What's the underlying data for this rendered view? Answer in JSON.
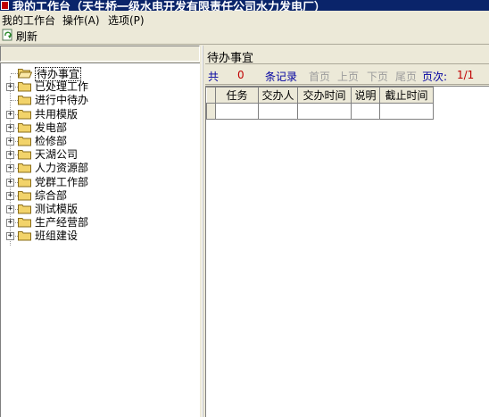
{
  "window": {
    "title": "我的工作台（天生桥一级水电开发有限责任公司水力发电厂）"
  },
  "menu": {
    "items": [
      {
        "label": "我的工作台"
      },
      {
        "label": "操作(A)"
      },
      {
        "label": "选项(P)"
      }
    ]
  },
  "toolbar": {
    "refresh_label": "刷新",
    "refresh_icon": "refresh-icon"
  },
  "tree": {
    "items": [
      {
        "label": "待办事宜",
        "expandable": false,
        "selected": true,
        "icon": "folder-open-icon"
      },
      {
        "label": "已处理工作",
        "expandable": true,
        "selected": false,
        "icon": "folder-icon"
      },
      {
        "label": "进行中待办",
        "expandable": false,
        "selected": false,
        "icon": "folder-icon"
      },
      {
        "label": "共用模版",
        "expandable": true,
        "selected": false,
        "icon": "folder-icon"
      },
      {
        "label": "发电部",
        "expandable": true,
        "selected": false,
        "icon": "folder-icon"
      },
      {
        "label": "检修部",
        "expandable": true,
        "selected": false,
        "icon": "folder-icon"
      },
      {
        "label": "天湖公司",
        "expandable": true,
        "selected": false,
        "icon": "folder-icon"
      },
      {
        "label": "人力资源部",
        "expandable": true,
        "selected": false,
        "icon": "folder-icon"
      },
      {
        "label": "党群工作部",
        "expandable": true,
        "selected": false,
        "icon": "folder-icon"
      },
      {
        "label": "综合部",
        "expandable": true,
        "selected": false,
        "icon": "folder-icon"
      },
      {
        "label": "测试模版",
        "expandable": true,
        "selected": false,
        "icon": "folder-icon"
      },
      {
        "label": "生产经营部",
        "expandable": true,
        "selected": false,
        "icon": "folder-icon"
      },
      {
        "label": "班组建设",
        "expandable": true,
        "selected": false,
        "icon": "folder-icon"
      }
    ]
  },
  "right_panel": {
    "title": "待办事宜"
  },
  "pager": {
    "total_prefix": "共",
    "total_count": "0",
    "total_suffix": "条记录",
    "first": "首页",
    "prev": "上页",
    "next": "下页",
    "last": "尾页",
    "page_label": "页次:",
    "page_value": "1/1"
  },
  "grid": {
    "columns": [
      "任务",
      "交办人",
      "交办时间",
      "说明",
      "截止时间"
    ]
  },
  "colors": {
    "titlebar": "#0a246a",
    "face": "#ece9d8",
    "link_blue": "#0000a0",
    "count_red": "#c00000",
    "disabled": "#9c9c9c",
    "folder": "#f2d36a"
  }
}
